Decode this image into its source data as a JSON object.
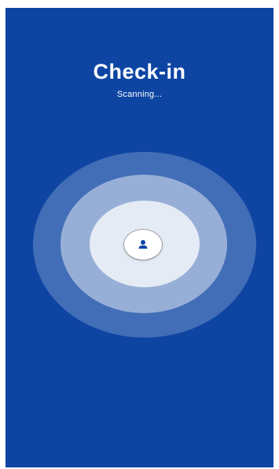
{
  "header": {
    "title": "Check-in",
    "status": "Scanning..."
  },
  "scanner": {
    "center_icon": "person-icon"
  },
  "colors": {
    "background": "#0e45a3",
    "ring": "#ffffff",
    "icon": "#0e45a3"
  }
}
